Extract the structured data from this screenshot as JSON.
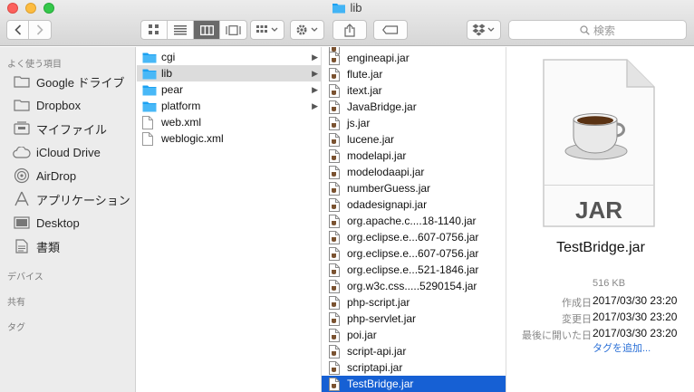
{
  "window": {
    "title": "lib"
  },
  "search": {
    "placeholder": "検索"
  },
  "sidebar": {
    "favorites_header": "よく使う項目",
    "devices_header": "デバイス",
    "shared_header": "共有",
    "tags_header": "タグ",
    "items": [
      {
        "label": "Google ドライブ",
        "icon": "drive-folder-icon"
      },
      {
        "label": "Dropbox",
        "icon": "folder-icon"
      },
      {
        "label": "マイファイル",
        "icon": "all-files-icon"
      },
      {
        "label": "iCloud Drive",
        "icon": "cloud-icon"
      },
      {
        "label": "AirDrop",
        "icon": "airdrop-icon"
      },
      {
        "label": "アプリケーション",
        "icon": "applications-icon"
      },
      {
        "label": "Desktop",
        "icon": "desktop-icon"
      },
      {
        "label": "書類",
        "icon": "document-icon"
      }
    ]
  },
  "column1": {
    "items": [
      {
        "label": "cgi",
        "type": "folder"
      },
      {
        "label": "lib",
        "type": "folder",
        "selected": true
      },
      {
        "label": "pear",
        "type": "folder"
      },
      {
        "label": "platform",
        "type": "folder"
      },
      {
        "label": "web.xml",
        "type": "file"
      },
      {
        "label": "weblogic.xml",
        "type": "file"
      }
    ]
  },
  "column2": {
    "items": [
      "engineapi.jar",
      "flute.jar",
      "itext.jar",
      "JavaBridge.jar",
      "js.jar",
      "lucene.jar",
      "modelapi.jar",
      "modelodaapi.jar",
      "numberGuess.jar",
      "odadesignapi.jar",
      "org.apache.c....18-1140.jar",
      "org.eclipse.e...607-0756.jar",
      "org.eclipse.e...607-0756.jar",
      "org.eclipse.e...521-1846.jar",
      "org.w3c.css.....5290154.jar",
      "php-script.jar",
      "php-servlet.jar",
      "poi.jar",
      "script-api.jar",
      "scriptapi.jar",
      "TestBridge.jar"
    ],
    "selected_index": 20
  },
  "preview": {
    "icon_label": "JAR",
    "file_name": "TestBridge.jar",
    "size": "516 KB",
    "created_label": "作成日",
    "created_value": "2017/03/30 23:20",
    "modified_label": "変更日",
    "modified_value": "2017/03/30 23:20",
    "opened_label": "最後に開いた日",
    "opened_value": "2017/03/30 23:20",
    "add_tags": "タグを追加..."
  },
  "colors": {
    "selection": "#1660d4",
    "folder": "#1ba1f2",
    "tag_link": "#2a6fd6"
  }
}
